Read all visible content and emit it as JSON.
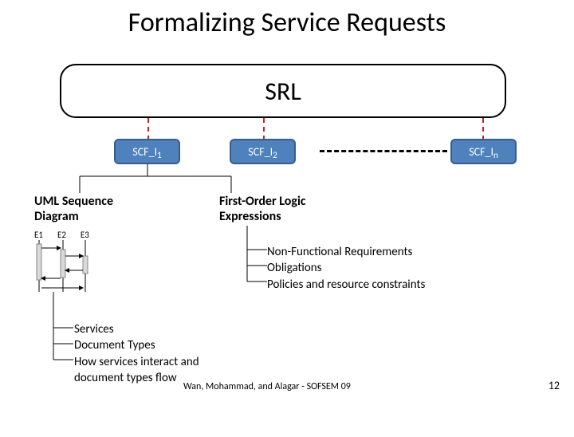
{
  "title": "Formalizing Service Requests",
  "srl": "SRL",
  "scf": {
    "prefix": "SCF_I",
    "sub1": "1",
    "sub2": "2",
    "subn": "n"
  },
  "uml_label_l1": "UML Sequence",
  "uml_label_l2": "Diagram",
  "seq_headers": {
    "e1": "E1",
    "e2": "E2",
    "e3": "E3"
  },
  "fol_label_l1": "First-Order Logic",
  "fol_label_l2": "Expressions",
  "branch1": {
    "i1": "Non-Functional Requirements",
    "i2": "Obligations",
    "i3": "Policies and resource constraints"
  },
  "branch2": {
    "i1": "Services",
    "i2": "Document Types",
    "i3": "How services interact and",
    "i4": "document types flow"
  },
  "footer": "Wan, Mohammad, and Alagar - SOFSEM 09",
  "page": "12"
}
